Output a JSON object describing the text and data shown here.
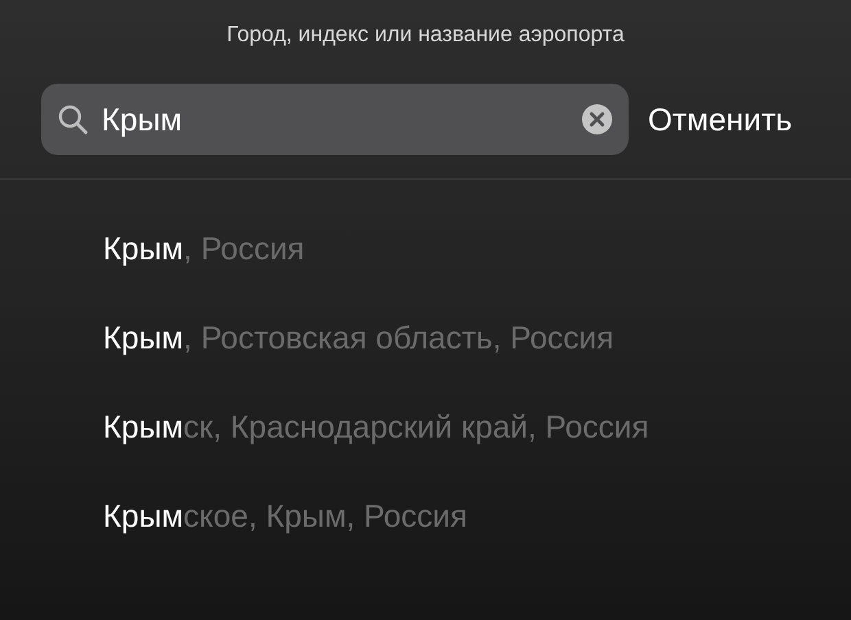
{
  "header": {
    "title": "Город, индекс или название аэропорта"
  },
  "search": {
    "value": "Крым",
    "cancel": "Отменить"
  },
  "results": [
    {
      "match": "Крым",
      "rest": ", Россия"
    },
    {
      "match": "Крым",
      "rest": ", Ростовская область, Россия"
    },
    {
      "match": "Крым",
      "rest": "ск, Краснодарский край, Россия"
    },
    {
      "match": "Крым",
      "rest": "ское, Крым, Россия"
    }
  ]
}
